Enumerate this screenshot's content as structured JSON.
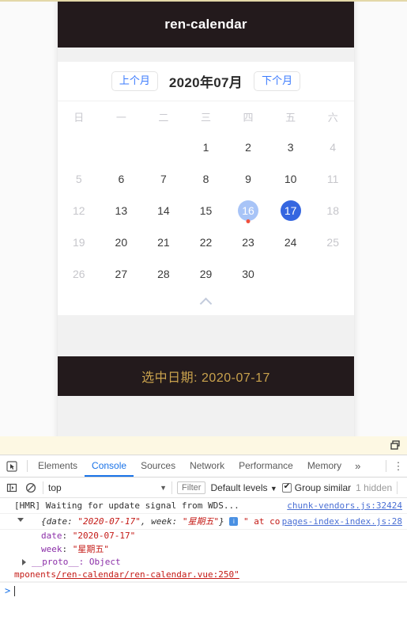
{
  "app": {
    "title": "ren-calendar"
  },
  "calendar": {
    "prev_label": "上个月",
    "next_label": "下个月",
    "month_title": "2020年07月",
    "weekdays": [
      "日",
      "一",
      "二",
      "三",
      "四",
      "五",
      "六"
    ],
    "collapse_icon": "chevron-up-icon",
    "weeks": [
      [
        {
          "label": "",
          "blank": true
        },
        {
          "label": "",
          "blank": true
        },
        {
          "label": "",
          "blank": true
        },
        {
          "label": "1"
        },
        {
          "label": "2"
        },
        {
          "label": "3"
        },
        {
          "label": "4",
          "weekend": true
        }
      ],
      [
        {
          "label": "5",
          "weekend": true
        },
        {
          "label": "6"
        },
        {
          "label": "7"
        },
        {
          "label": "8"
        },
        {
          "label": "9"
        },
        {
          "label": "10"
        },
        {
          "label": "11",
          "weekend": true
        }
      ],
      [
        {
          "label": "12",
          "weekend": true
        },
        {
          "label": "13"
        },
        {
          "label": "14"
        },
        {
          "label": "15"
        },
        {
          "label": "16",
          "today": true,
          "dot": true
        },
        {
          "label": "17",
          "selected": true
        },
        {
          "label": "18",
          "weekend": true
        }
      ],
      [
        {
          "label": "19",
          "weekend": true
        },
        {
          "label": "20"
        },
        {
          "label": "21"
        },
        {
          "label": "22"
        },
        {
          "label": "23"
        },
        {
          "label": "24"
        },
        {
          "label": "25",
          "weekend": true
        }
      ],
      [
        {
          "label": "26",
          "weekend": true
        },
        {
          "label": "27"
        },
        {
          "label": "28"
        },
        {
          "label": "29"
        },
        {
          "label": "30"
        },
        {
          "label": "",
          "blank": true
        },
        {
          "label": "",
          "blank": true
        }
      ]
    ]
  },
  "result": {
    "text": "选中日期: 2020-07-17"
  },
  "devtools": {
    "tabs": [
      {
        "label": "Elements",
        "active": false
      },
      {
        "label": "Console",
        "active": true
      },
      {
        "label": "Sources",
        "active": false
      },
      {
        "label": "Network",
        "active": false
      },
      {
        "label": "Performance",
        "active": false
      },
      {
        "label": "Memory",
        "active": false
      }
    ],
    "more_label": "»",
    "kebab_label": "⋮",
    "inspect_icon": "inspect-element-icon",
    "dock_icon": "dock-position-icon",
    "toolbar": {
      "sidebar_icon": "console-sidebar-icon",
      "clear_icon": "clear-console-icon",
      "context": "top",
      "context_caret": "▼",
      "filter_placeholder": "Filter",
      "levels_label": "Default levels",
      "levels_caret": "▼",
      "group_similar_label": "Group similar",
      "group_similar_checked": true,
      "hidden_label": "1 hidden"
    },
    "messages": {
      "hmr_text": "[HMR] Waiting for update signal from WDS...",
      "hmr_source": "chunk-vendors.js:32424",
      "object_prefix": "{date: ",
      "object_date_val": "\"2020-07-17\"",
      "object_mid": ", week: ",
      "object_week_val": "\"星期五\"",
      "object_suffix": "}",
      "object_badge": "i",
      "object_trailing": "\"  at co",
      "object_source": "pages-index-index.js:28",
      "prop_date_key": "date",
      "prop_date_val": "\"2020-07-17\"",
      "prop_week_key": "week",
      "prop_week_val": "\"星期五\"",
      "proto_label": "__proto__: Object",
      "tail_red": "mponents",
      "tail_link": "/ren-calendar/ren-calendar.vue:250\""
    },
    "prompt": {
      "caret": ">",
      "value": ""
    }
  },
  "colors": {
    "app_bar_bg": "#231a1c",
    "accent_blue": "#3566e0",
    "today_blue": "#a8c4f7",
    "dot_red": "#f0503c",
    "result_gold": "#c9a24d",
    "tab_active": "#1a73e8"
  }
}
